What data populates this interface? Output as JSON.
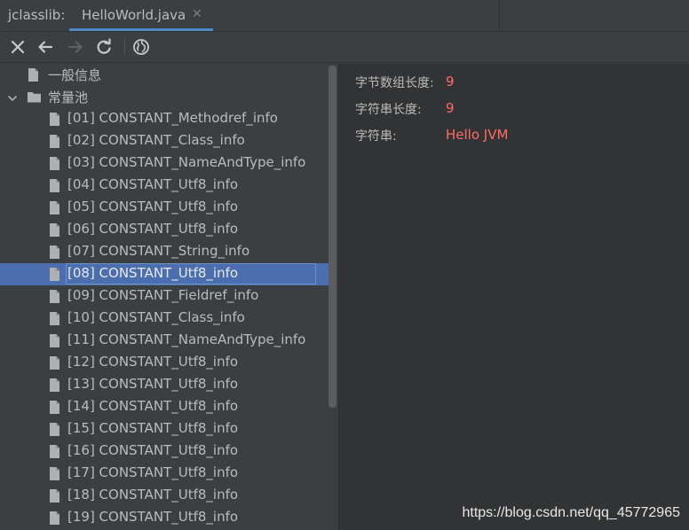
{
  "window": {
    "tool_title": "jclasslib:",
    "tab": {
      "label": "HelloWorld.java",
      "close": "✕"
    }
  },
  "toolbar": {
    "buttons": [
      {
        "name": "close-icon",
        "icon": "close",
        "enabled": true
      },
      {
        "name": "arrow-left-icon",
        "icon": "back",
        "enabled": true
      },
      {
        "name": "arrow-right-icon",
        "icon": "forward",
        "enabled": false
      },
      {
        "name": "refresh-icon",
        "icon": "refresh",
        "enabled": true
      },
      {
        "name": "globe-icon",
        "icon": "web",
        "enabled": true
      }
    ]
  },
  "tree": {
    "items": [
      {
        "label": "一般信息",
        "icon": "file-icon",
        "depth": 1
      },
      {
        "label": "常量池",
        "icon": "folder-icon",
        "depth": 0,
        "expanded": true
      },
      {
        "label": "[01] CONSTANT_Methodref_info",
        "icon": "file-icon",
        "depth": 2
      },
      {
        "label": "[02] CONSTANT_Class_info",
        "icon": "file-icon",
        "depth": 2
      },
      {
        "label": "[03] CONSTANT_NameAndType_info",
        "icon": "file-icon",
        "depth": 2
      },
      {
        "label": "[04] CONSTANT_Utf8_info",
        "icon": "file-icon",
        "depth": 2
      },
      {
        "label": "[05] CONSTANT_Utf8_info",
        "icon": "file-icon",
        "depth": 2
      },
      {
        "label": "[06] CONSTANT_Utf8_info",
        "icon": "file-icon",
        "depth": 2
      },
      {
        "label": "[07] CONSTANT_String_info",
        "icon": "file-icon",
        "depth": 2
      },
      {
        "label": "[08] CONSTANT_Utf8_info",
        "icon": "file-icon",
        "depth": 2,
        "selected": true
      },
      {
        "label": "[09] CONSTANT_Fieldref_info",
        "icon": "file-icon",
        "depth": 2
      },
      {
        "label": "[10] CONSTANT_Class_info",
        "icon": "file-icon",
        "depth": 2
      },
      {
        "label": "[11] CONSTANT_NameAndType_info",
        "icon": "file-icon",
        "depth": 2
      },
      {
        "label": "[12] CONSTANT_Utf8_info",
        "icon": "file-icon",
        "depth": 2
      },
      {
        "label": "[13] CONSTANT_Utf8_info",
        "icon": "file-icon",
        "depth": 2
      },
      {
        "label": "[14] CONSTANT_Utf8_info",
        "icon": "file-icon",
        "depth": 2
      },
      {
        "label": "[15] CONSTANT_Utf8_info",
        "icon": "file-icon",
        "depth": 2
      },
      {
        "label": "[16] CONSTANT_Utf8_info",
        "icon": "file-icon",
        "depth": 2
      },
      {
        "label": "[17] CONSTANT_Utf8_info",
        "icon": "file-icon",
        "depth": 2
      },
      {
        "label": "[18] CONSTANT_Utf8_info",
        "icon": "file-icon",
        "depth": 2
      },
      {
        "label": "[19] CONSTANT_Utf8_info",
        "icon": "file-icon",
        "depth": 2
      }
    ]
  },
  "detail": {
    "fields": [
      {
        "key": "字节数组长度:",
        "value": "9"
      },
      {
        "key": "字符串长度:",
        "value": "9"
      },
      {
        "key": "字符串:",
        "value": "Hello JVM"
      }
    ]
  },
  "watermark": "https://blog.csdn.net/qq_45772965",
  "colors": {
    "background": "#3c3f41",
    "detail_background": "#313335",
    "selection": "#4b6eaf",
    "accent": "#4a88c7",
    "value_text": "#ff6b68"
  }
}
